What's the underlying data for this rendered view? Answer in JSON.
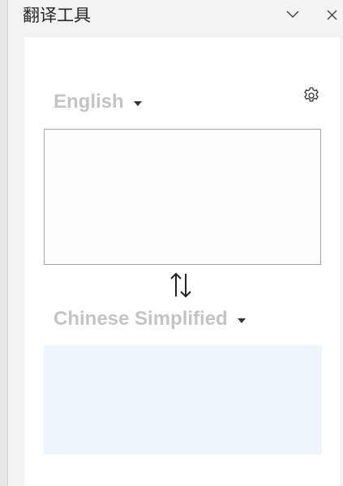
{
  "header": {
    "title": "翻译工具",
    "collapse_icon": "chevron-down-icon",
    "close_icon": "close-icon"
  },
  "translator": {
    "source_language": "English",
    "target_language": "Chinese Simplified",
    "source_text": "",
    "target_text": "",
    "settings_icon": "gear-icon",
    "swap_icon": "swap-arrows-icon"
  },
  "colors": {
    "pane_background": "#f3f3f3",
    "card_background": "#ffffff",
    "language_label": "#c4c4c4",
    "target_box_background": "#eef5fd",
    "source_box_border": "#a6a6a6"
  }
}
